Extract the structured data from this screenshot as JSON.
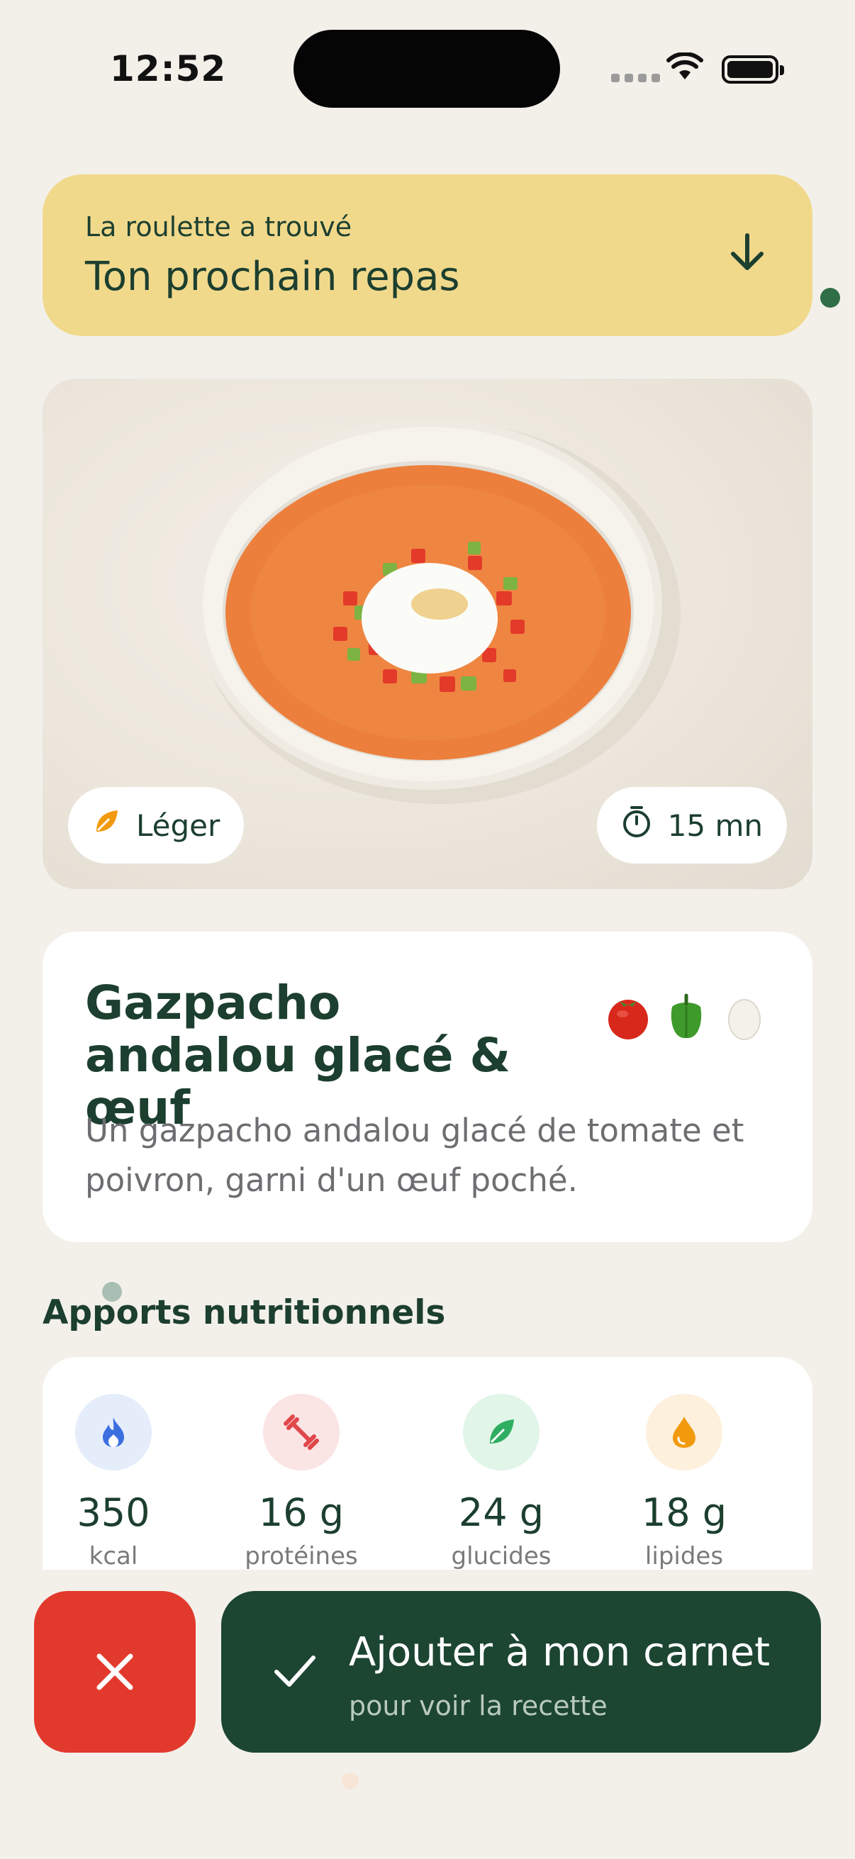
{
  "status_bar": {
    "time": "12:52"
  },
  "banner": {
    "subtitle": "La roulette a trouvé",
    "title": "Ton prochain repas"
  },
  "hero": {
    "tag_label": "Léger",
    "time_label": "15 mn"
  },
  "recipe": {
    "title": "Gazpacho andalou glacé & œuf",
    "description": "Un gazpacho andalou glacé de tomate et poivron, garni d'un œuf poché.",
    "ingredient_icons": [
      "tomato-icon",
      "bell-pepper-icon",
      "egg-icon"
    ]
  },
  "nutrition": {
    "heading": "Apports nutritionnels",
    "items": [
      {
        "value": "350",
        "label": "kcal",
        "icon": "flame-icon",
        "color": "#3b6fe0",
        "bg": "#e5edfb"
      },
      {
        "value": "16 g",
        "label": "protéines",
        "icon": "dumbbell-icon",
        "color": "#e0474a",
        "bg": "#fbe4e4"
      },
      {
        "value": "24 g",
        "label": "glucides",
        "icon": "leaf-icon",
        "color": "#2fae62",
        "bg": "#e1f5e8"
      },
      {
        "value": "18 g",
        "label": "lipides",
        "icon": "drop-icon",
        "color": "#f29a0e",
        "bg": "#fdf0dc"
      }
    ]
  },
  "actions": {
    "add_title": "Ajouter à mon carnet",
    "add_subtitle": "pour voir la recette"
  },
  "colors": {
    "background": "#f3f0ea",
    "banner": "#f1d98c",
    "primary_dark_green": "#1c4532",
    "reject_red": "#e2392d"
  }
}
